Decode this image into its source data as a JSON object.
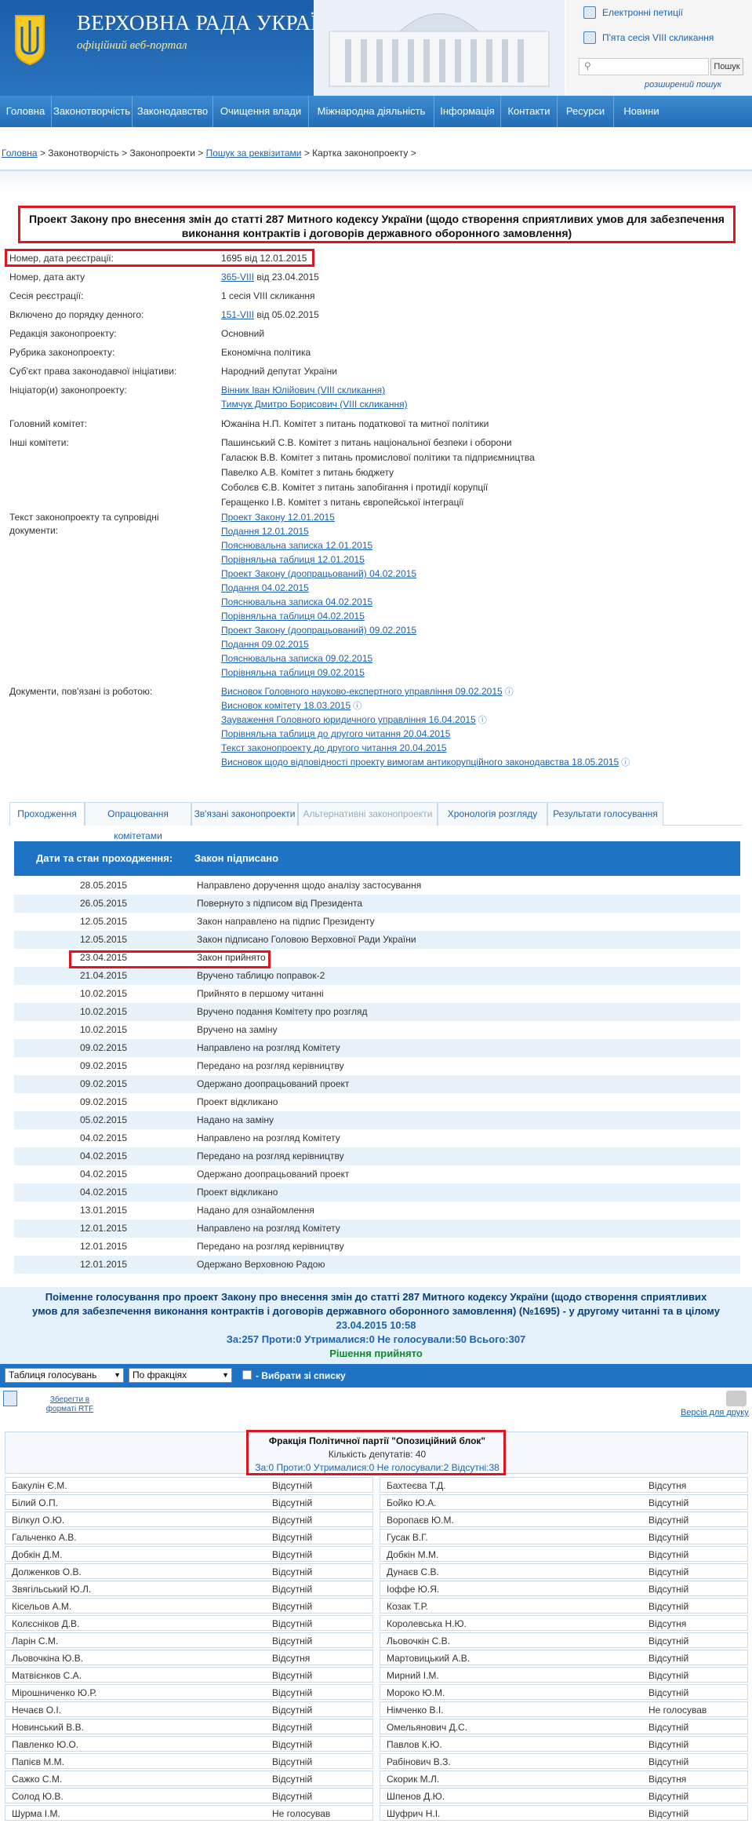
{
  "header": {
    "title": "ВЕРХОВНА РАДА УКРАЇНИ",
    "subtitle": "офіційний веб-портал",
    "links": [
      {
        "label": "Електронні петиції"
      },
      {
        "label": "П'ята сесія VIII скликання"
      }
    ],
    "search_placeholder": "",
    "search_button": "Пошук",
    "advanced_search": "розширений пошук"
  },
  "nav": [
    "Головна",
    "Законотворчість",
    "Законодавство",
    "Очищення влади",
    "Міжнародна діяльність",
    "Інформація",
    "Контакти",
    "Ресурси",
    "Новини"
  ],
  "breadcrumb": {
    "home": "Головна",
    "sep": ">",
    "b2": "Законотворчість",
    "b3": "Законопроекти",
    "b4": "Пошук за реквізитами",
    "b5": "Картка законопроекту"
  },
  "bill": {
    "title": "Проект Закону про внесення змін до статті 287 Митного кодексу України (щодо створення сприятливих умов для забезпечення виконання контрактів і договорів державного оборонного замовлення)",
    "fields": [
      {
        "label": "Номер, дата реєстрації:",
        "value": "1695 від 12.01.2015"
      },
      {
        "label": "Номер, дата акту",
        "link": "365-VIII",
        "value": " від 23.04.2015"
      },
      {
        "label": "Сесія реєстрації:",
        "value": "1 сесія VIII скликання"
      },
      {
        "label": "Включено до порядку денного:",
        "link": "151-VIII",
        "value": " від 05.02.2015"
      },
      {
        "label": "Редакція законопроекту:",
        "value": "Основний"
      },
      {
        "label": "Рубрика законопроекту:",
        "value": "Економічна політика"
      },
      {
        "label": "Суб'єкт права законодавчої ініціативи:",
        "value": "Народний депутат України"
      }
    ],
    "initiators_label": "Ініціатор(и) законопроекту:",
    "initiators": [
      "Вінник Іван Юлійович (VIII скликання)",
      "Тимчук Дмитро Борисович (VIII скликання)"
    ],
    "main_committee_label": "Головний комітет:",
    "main_committee": "Южаніна Н.П. Комітет з питань податкової та митної політики",
    "other_committees_label": "Інші комітети:",
    "other_committees": [
      "Пашинський С.В. Комітет з питань національної безпеки і оборони",
      "Галасюк В.В. Комітет з питань промислової політики та підприємництва",
      "Павелко А.В. Комітет з питань бюджету",
      "Соболєв Є.В. Комітет з питань запобігання і протидії корупції",
      "Геращенко І.В. Комітет з питань європейської інтеграції"
    ],
    "docs_label": "Текст законопроекту та супровідні документи:",
    "docs": [
      "Проект Закону 12.01.2015",
      "Подання 12.01.2015",
      "Пояснювальна записка 12.01.2015",
      "Порівняльна таблиця 12.01.2015",
      "Проект Закону (доопрацьований) 04.02.2015",
      "Подання 04.02.2015",
      "Пояснювальна записка 04.02.2015",
      "Порівняльна таблиця 04.02.2015",
      "Проект Закону (доопрацьований) 09.02.2015",
      "Подання 09.02.2015",
      "Пояснювальна записка 09.02.2015",
      "Порівняльна таблиця 09.02.2015"
    ],
    "related_label": "Документи, пов'язані із роботою:",
    "related": [
      "Висновок Головного науково-експертного управління 09.02.2015",
      "Висновок комітету 18.03.2015",
      "Зауваження Головного юридичного управління 16.04.2015",
      "Порівняльна таблиця до другого читання 20.04.2015",
      "Текст законопроекту до другого читання 20.04.2015",
      "Висновок щодо відповідності проекту вимогам антикорупційного законодавства 18.05.2015"
    ]
  },
  "tabs": [
    "Проходження",
    "Опрацювання комітетами",
    "Зв'язані законопроекти",
    "Альтернативні законопроекти",
    "Хронологія розгляду",
    "Результати голосування"
  ],
  "stages": {
    "header_date": "Дати та стан проходження:",
    "header_status": "Закон підписано",
    "rows": [
      [
        "28.05.2015",
        "Направлено доручення щодо аналізу застосування"
      ],
      [
        "26.05.2015",
        "Повернуто з підписом від Президента"
      ],
      [
        "12.05.2015",
        "Закон направлено на підпис Президенту"
      ],
      [
        "12.05.2015",
        "Закон підписано Головою Верховної Ради України"
      ],
      [
        "23.04.2015",
        "Закон прийнято"
      ],
      [
        "21.04.2015",
        "Вручено таблицю поправок-2"
      ],
      [
        "10.02.2015",
        "Прийнято в першому читанні"
      ],
      [
        "10.02.2015",
        "Вручено подання Комітету про розгляд"
      ],
      [
        "10.02.2015",
        "Вручено на заміну"
      ],
      [
        "09.02.2015",
        "Направлено на розгляд Комітету"
      ],
      [
        "09.02.2015",
        "Передано на розгляд керівництву"
      ],
      [
        "09.02.2015",
        "Одержано доопрацьований проект"
      ],
      [
        "09.02.2015",
        "Проект відкликано"
      ],
      [
        "05.02.2015",
        "Надано на заміну"
      ],
      [
        "04.02.2015",
        "Направлено на розгляд Комітету"
      ],
      [
        "04.02.2015",
        "Передано на розгляд керівництву"
      ],
      [
        "04.02.2015",
        "Одержано доопрацьований проект"
      ],
      [
        "04.02.2015",
        "Проект відкликано"
      ],
      [
        "13.01.2015",
        "Надано для ознайомлення"
      ],
      [
        "12.01.2015",
        "Направлено на розгляд Комітету"
      ],
      [
        "12.01.2015",
        "Передано на розгляд керівництву"
      ],
      [
        "12.01.2015",
        "Одержано Верховною Радою"
      ]
    ]
  },
  "vote": {
    "title": "Поіменне голосування про проект Закону про внесення змін до статті 287 Митного кодексу України (щодо створення сприятливих умов для забезпечення виконання контрактів і договорів державного оборонного замовлення) (№1695) - у другому читанні та в цілому",
    "datetime": "23.04.2015 10:58",
    "totals": "За:257 Проти:0 Утрималися:0 Не голосували:50 Всього:307",
    "decision": "Рішення прийнято",
    "select1": "Таблиця голосувань",
    "select2": "По фракціях",
    "checkbox_label": "- Вибрати зі списку",
    "rtf": "Зберегти в форматі RTF",
    "print": "Версія для друку"
  },
  "faction": {
    "name": "Фракція Політичної партії \"Опозиційний блок\"",
    "count": "Кількість депутатів: 40",
    "totals": "За:0 Проти:0 Утрималися:0 Не голосували:2 Відсутні:38"
  },
  "deputies_left": [
    [
      "Бакулін Є.М.",
      "Відсутній"
    ],
    [
      "Білий О.П.",
      "Відсутній"
    ],
    [
      "Вілкул О.Ю.",
      "Відсутній"
    ],
    [
      "Гальченко А.В.",
      "Відсутній"
    ],
    [
      "Добкін Д.М.",
      "Відсутній"
    ],
    [
      "Долженков О.В.",
      "Відсутній"
    ],
    [
      "Звягільський Ю.Л.",
      "Відсутній"
    ],
    [
      "Кісельов А.М.",
      "Відсутній"
    ],
    [
      "Колєсніков Д.В.",
      "Відсутній"
    ],
    [
      "Ларін С.М.",
      "Відсутній"
    ],
    [
      "Льовочкіна Ю.В.",
      "Відсутня"
    ],
    [
      "Матвієнков С.А.",
      "Відсутній"
    ],
    [
      "Мірошниченко Ю.Р.",
      "Відсутній"
    ],
    [
      "Нечаєв О.І.",
      "Відсутній"
    ],
    [
      "Новинський В.В.",
      "Відсутній"
    ],
    [
      "Павленко Ю.О.",
      "Відсутній"
    ],
    [
      "Папієв М.М.",
      "Відсутній"
    ],
    [
      "Сажко С.М.",
      "Відсутній"
    ],
    [
      "Солод Ю.В.",
      "Відсутній"
    ],
    [
      "Шурма І.М.",
      "Не голосував"
    ]
  ],
  "deputies_right": [
    [
      "Бахтеєва Т.Д.",
      "Відсутня"
    ],
    [
      "Бойко Ю.А.",
      "Відсутній"
    ],
    [
      "Воропаєв Ю.М.",
      "Відсутній"
    ],
    [
      "Гусак В.Г.",
      "Відсутній"
    ],
    [
      "Добкін М.М.",
      "Відсутній"
    ],
    [
      "Дунаєв С.В.",
      "Відсутній"
    ],
    [
      "Іоффе Ю.Я.",
      "Відсутній"
    ],
    [
      "Козак Т.Р.",
      "Відсутній"
    ],
    [
      "Королевська Н.Ю.",
      "Відсутня"
    ],
    [
      "Льовочкін С.В.",
      "Відсутній"
    ],
    [
      "Мартовицький А.В.",
      "Відсутній"
    ],
    [
      "Мирний І.М.",
      "Відсутній"
    ],
    [
      "Мороко Ю.М.",
      "Відсутній"
    ],
    [
      "Німченко В.І.",
      "Не голосував"
    ],
    [
      "Омельянович Д.С.",
      "Відсутній"
    ],
    [
      "Павлов К.Ю.",
      "Відсутній"
    ],
    [
      "Рабінович В.З.",
      "Відсутній"
    ],
    [
      "Скорик М.Л.",
      "Відсутня"
    ],
    [
      "Шпенов Д.Ю.",
      "Відсутній"
    ],
    [
      "Шуфрич Н.І.",
      "Відсутній"
    ]
  ]
}
